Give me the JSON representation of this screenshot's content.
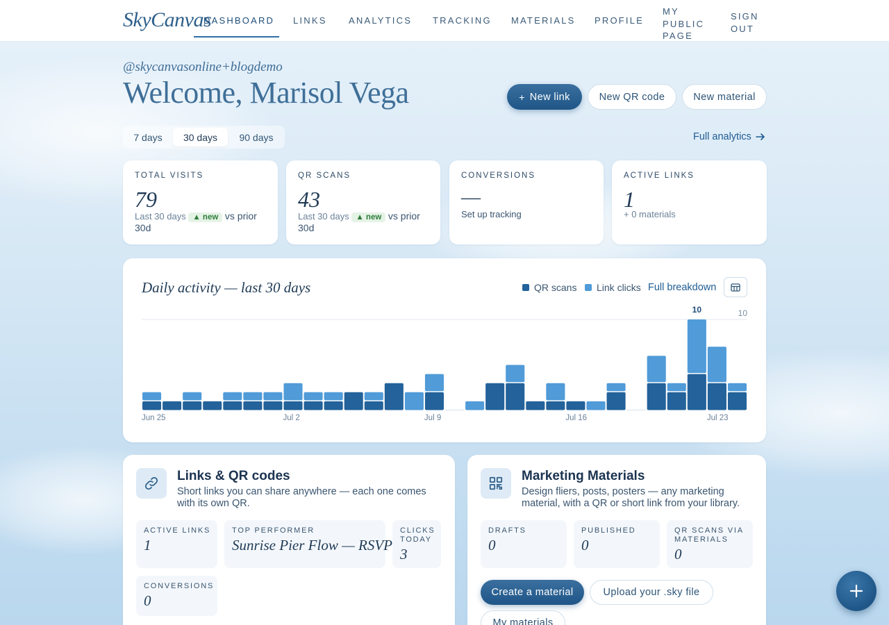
{
  "nav": {
    "brand": "SkyCanvas",
    "items": [
      {
        "label": "DASHBOARD",
        "active": true
      },
      {
        "label": "LINKS"
      },
      {
        "label": "ANALYTICS"
      },
      {
        "label": "TRACKING"
      },
      {
        "label": "MATERIALS"
      },
      {
        "label": "PROFILE"
      },
      {
        "label_lines": [
          "MY",
          "PUBLIC",
          "PAGE"
        ]
      },
      {
        "label_lines": [
          "SIGN",
          "OUT"
        ]
      }
    ]
  },
  "header": {
    "handle": "@skycanvasonline+blogdemo",
    "welcome": "Welcome, Marisol Vega",
    "actions": {
      "new_link": "New link",
      "new_link_prefix": "+",
      "new_qr": "New QR code",
      "new_material": "New material"
    }
  },
  "range": {
    "options": [
      "7 days",
      "30 days",
      "90 days"
    ],
    "selected": "30 days",
    "full_analytics": "Full analytics"
  },
  "stats": {
    "total_visits": {
      "label": "TOTAL VISITS",
      "value": "79",
      "period": "Last 30 days",
      "badge": "▲ new",
      "compare": "vs prior 30d"
    },
    "qr_scans": {
      "label": "QR SCANS",
      "value": "43",
      "period": "Last 30 days",
      "badge": "▲ new",
      "compare": "vs prior 30d"
    },
    "conversions": {
      "label": "CONVERSIONS",
      "value": "—",
      "sub": "Set up tracking"
    },
    "active_links": {
      "label": "ACTIVE LINKS",
      "value": "1",
      "sub": "+ 0 materials"
    }
  },
  "activity": {
    "title": "Daily activity — last 30 days",
    "legend": {
      "qr": "QR scans",
      "clicks": "Link clicks"
    },
    "full_breakdown": "Full breakdown",
    "colors": {
      "qr": "#23629a",
      "clicks": "#509bd8"
    }
  },
  "chart_data": {
    "type": "bar",
    "stacked": true,
    "categories": [
      "Jun 25",
      "Jun 26",
      "Jun 27",
      "Jun 28",
      "Jun 29",
      "Jun 30",
      "Jul 1",
      "Jul 2",
      "Jul 3",
      "Jul 4",
      "Jul 5",
      "Jul 6",
      "Jul 7",
      "Jul 8",
      "Jul 9",
      "Jul 10",
      "Jul 11",
      "Jul 12",
      "Jul 13",
      "Jul 14",
      "Jul 15",
      "Jul 16",
      "Jul 17",
      "Jul 18",
      "Jul 19",
      "Jul 20",
      "Jul 21",
      "Jul 22",
      "Jul 23",
      "Jul 24"
    ],
    "x_tick_labels": [
      "Jun 25",
      "Jul 2",
      "Jul 9",
      "Jul 16",
      "Jul 23"
    ],
    "series": [
      {
        "name": "QR scans",
        "values": [
          1,
          1,
          1,
          1,
          1,
          1,
          1,
          1,
          1,
          1,
          2,
          1,
          3,
          0,
          2,
          0,
          0,
          3,
          3,
          1,
          1,
          1,
          0,
          2,
          0,
          3,
          2,
          4,
          3,
          2
        ]
      },
      {
        "name": "Link clicks",
        "values": [
          1,
          0,
          1,
          0,
          1,
          1,
          1,
          2,
          1,
          1,
          0,
          1,
          0,
          2,
          2,
          0,
          1,
          0,
          2,
          0,
          2,
          0,
          1,
          1,
          0,
          3,
          1,
          6,
          4,
          1
        ]
      }
    ],
    "ylim": [
      0,
      10
    ],
    "y_max_label": "10",
    "peak_label": "10",
    "grid": true
  },
  "links_card": {
    "title": "Links & QR codes",
    "desc": "Short links you can share anywhere — each one comes with its own QR.",
    "tiles": {
      "active_links": {
        "label": "ACTIVE LINKS",
        "value": "1"
      },
      "top_performer": {
        "label": "TOP PERFORMER",
        "value": "Sunrise Pier Flow — RSVP"
      },
      "clicks_today": {
        "label_lines": [
          "CLICKS",
          "TODAY"
        ],
        "value": "3"
      },
      "conversions": {
        "label": "CONVERSIONS",
        "value": "0"
      }
    }
  },
  "materials_card": {
    "title": "Marketing Materials",
    "desc": "Design fliers, posts, posters — any marketing material, with a QR or short link from your library.",
    "tiles": {
      "drafts": {
        "label": "DRAFTS",
        "value": "0"
      },
      "published": {
        "label": "PUBLISHED",
        "value": "0"
      },
      "qr_scans": {
        "label_lines": [
          "QR SCANS VIA",
          "MATERIALS"
        ],
        "value": "0"
      }
    },
    "actions": {
      "create": "Create a material",
      "upload": "Upload your .sky file",
      "my": "My materials"
    }
  }
}
